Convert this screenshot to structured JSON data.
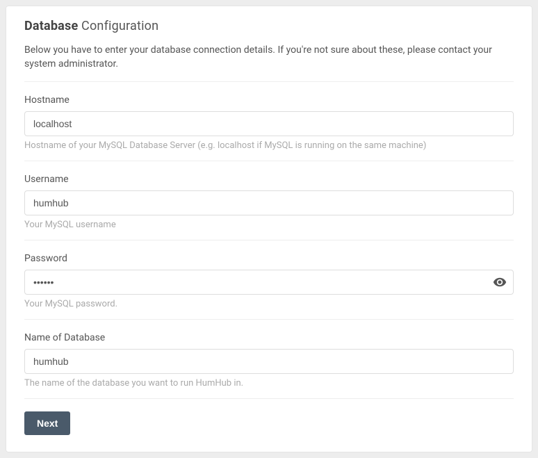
{
  "header": {
    "title_strong": "Database",
    "title_rest": " Configuration"
  },
  "intro": "Below you have to enter your database connection details. If you're not sure about these, please contact your system administrator.",
  "form": {
    "hostname": {
      "label": "Hostname",
      "value": "localhost",
      "hint": "Hostname of your MySQL Database Server (e.g. localhost if MySQL is running on the same machine)"
    },
    "username": {
      "label": "Username",
      "value": "humhub",
      "hint": "Your MySQL username"
    },
    "password": {
      "label": "Password",
      "value": "••••••",
      "hint": "Your MySQL password."
    },
    "dbname": {
      "label": "Name of Database",
      "value": "humhub",
      "hint": "The name of the database you want to run HumHub in."
    }
  },
  "actions": {
    "next": "Next"
  }
}
